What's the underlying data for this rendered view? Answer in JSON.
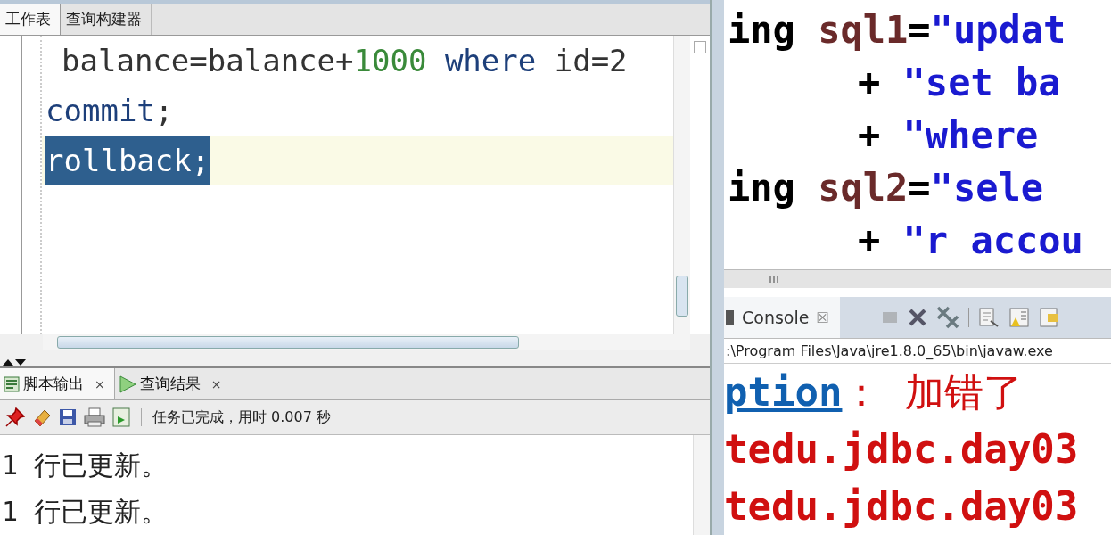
{
  "worksheet_tabs": [
    {
      "label": "工作表",
      "selected": true
    },
    {
      "label": "查询构建器",
      "selected": false
    }
  ],
  "sql_editor": {
    "lines": [
      {
        "indented": true,
        "current": false,
        "tokens": [
          {
            "kind": "plain",
            "text": "balance=balance+"
          },
          {
            "kind": "number",
            "text": "1000"
          },
          {
            "kind": "keyword",
            "text": " where"
          },
          {
            "kind": "plain",
            "text": " id=2"
          }
        ]
      },
      {
        "indented": false,
        "current": false,
        "tokens": [
          {
            "kind": "keyword",
            "text": "commit"
          },
          {
            "kind": "plain",
            "text": ";"
          }
        ]
      },
      {
        "indented": false,
        "current": true,
        "tokens": [
          {
            "kind": "selected",
            "text": "rollback;"
          }
        ]
      }
    ]
  },
  "output_tabs": [
    {
      "label": "脚本输出",
      "close": "×",
      "selected": true
    },
    {
      "label": "查询结果",
      "close": "×",
      "selected": false
    }
  ],
  "output_status": "任务已完成，用时 0.007 秒",
  "script_output": [
    "1 行已更新。",
    "1 行已更新。"
  ],
  "java_editor": {
    "lines": [
      {
        "indented": false,
        "tokens": [
          {
            "kind": "plain",
            "text": "ing "
          },
          {
            "kind": "variable",
            "text": "sql1"
          },
          {
            "kind": "plain",
            "text": "="
          },
          {
            "kind": "string",
            "text": "\"updat"
          }
        ]
      },
      {
        "indented": true,
        "tokens": [
          {
            "kind": "plain",
            "text": "+ "
          },
          {
            "kind": "string",
            "text": "\"set ba"
          }
        ]
      },
      {
        "indented": true,
        "tokens": [
          {
            "kind": "plain",
            "text": "+ "
          },
          {
            "kind": "string",
            "text": "\"where"
          }
        ]
      },
      {
        "indented": false,
        "tokens": [
          {
            "kind": "plain",
            "text": "ing "
          },
          {
            "kind": "variable",
            "text": "sql2"
          },
          {
            "kind": "plain",
            "text": "="
          },
          {
            "kind": "string",
            "text": "\"sele"
          }
        ]
      },
      {
        "indented": true,
        "tokens": [
          {
            "kind": "plain",
            "text": "+ "
          },
          {
            "kind": "string",
            "text": "\"r accou"
          }
        ]
      }
    ]
  },
  "console": {
    "tab": {
      "label": "Console",
      "close": "☒"
    },
    "launch_path": ":\\Program Files\\Java\\jre1.8.0_65\\bin\\javaw.exe",
    "lines": [
      {
        "tokens": [
          {
            "kind": "link",
            "text": "ption"
          },
          {
            "kind": "error",
            "text": "： 加错了"
          }
        ]
      },
      {
        "tokens": [
          {
            "kind": "error_bold",
            "text": "tedu.jdbc.day03"
          }
        ]
      },
      {
        "tokens": [
          {
            "kind": "error_bold",
            "text": "tedu.jdbc.day03"
          }
        ]
      }
    ]
  }
}
